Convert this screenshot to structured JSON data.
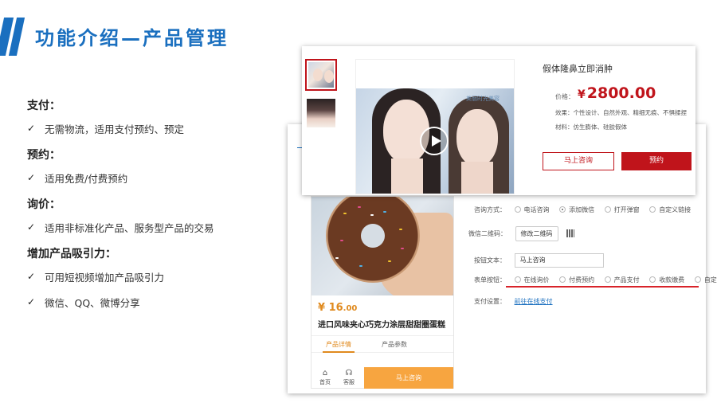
{
  "slide": {
    "title": "功能介绍—产品管理"
  },
  "features": [
    {
      "heading": "支付：",
      "items": [
        "无需物流，适用支付预约、预定"
      ]
    },
    {
      "heading": "预约：",
      "items": [
        "适用免费/付费预约"
      ]
    },
    {
      "heading": "询价：",
      "items": [
        "适用非标准化产品、服务型产品的交易"
      ]
    },
    {
      "heading": "增加产品吸引力：",
      "items": [
        "可用短视频增加产品吸引力",
        "微信、QQ、微博分享"
      ]
    }
  ],
  "check_glyph": "✓",
  "product_detail": {
    "title": "假体隆鼻立即消肿",
    "price_label": "价格：",
    "currency": "¥",
    "price": "2800.00",
    "effect": "效果：个性设计、自然外观、精细无痕、不惧揉捏",
    "material": "材料：仿生膨体、硅胶假体",
    "consult_button": "马上咨询",
    "book_button": "预约",
    "video_watermark": "美丽时光美容"
  },
  "mobile_preview": {
    "currency": "¥",
    "price": "16",
    "price_decimals": ".00",
    "product_name": "进口风味夹心巧克力涂层甜甜圈蛋糕",
    "tabs": [
      "产品详情",
      "产品参数"
    ],
    "home_label": "首页",
    "service_label": "客服",
    "consult_button": "马上咨询"
  },
  "settings": {
    "consult_method_label": "咨询方式：",
    "consult_options": [
      "电话咨询",
      "添加微信",
      "打开弹窗",
      "自定义链接"
    ],
    "wechat_qr_label": "微信二维码：",
    "edit_qr_button": "修改二维码",
    "button_text_label": "按钮文本：",
    "button_text_value": "马上咨询",
    "form_button_label": "表单按钮：",
    "form_button_options": [
      "在线询价",
      "付费预约",
      "产品支付",
      "收款缴费",
      "自定义"
    ],
    "payment_settings_label": "支付设置：",
    "payment_link": "前往在线支付"
  },
  "colors": {
    "accent_blue": "#1a6fbf",
    "brand_red": "#c0141b",
    "orange": "#f7a540"
  }
}
